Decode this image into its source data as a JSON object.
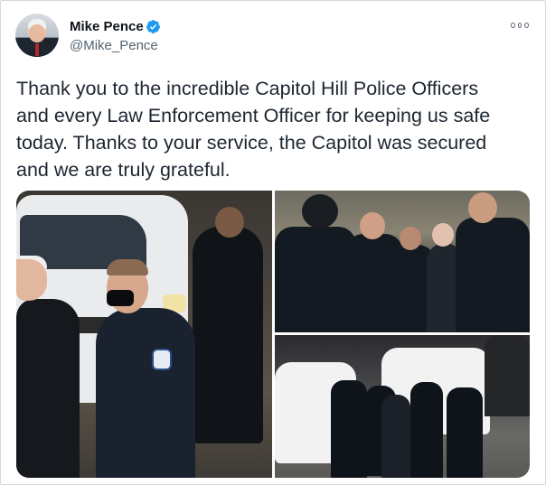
{
  "user": {
    "name": "Mike Pence",
    "handle": "@Mike_Pence",
    "verified": true,
    "avatar_icon": "profile-photo-avatar"
  },
  "tweet": {
    "text": "Thank you to the incredible Capitol Hill Police Officers\nand every Law Enforcement Officer for keeping us safe\ntoday. Thanks to your service, the Capitol was secured\nand we are truly grateful."
  },
  "icons": {
    "verified": "verified-badge-icon",
    "more": "more-options-icon"
  },
  "colors": {
    "verified_blue": "#1d9bf0",
    "text": "#1d2630",
    "muted": "#536471"
  },
  "media": {
    "count": 3
  }
}
